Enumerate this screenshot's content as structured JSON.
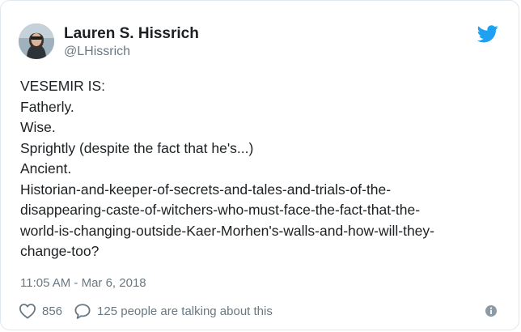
{
  "author": {
    "name": "Lauren S. Hissrich",
    "handle": "@LHissrich"
  },
  "tweet": {
    "lines": [
      "VESEMIR IS:",
      "Fatherly.",
      "Wise.",
      "Sprightly (despite the fact that he's...)",
      "Ancient.",
      "Historian-and-keeper-of-secrets-and-tales-and-trials-of-the-",
      "disappearing-caste-of-witchers-who-must-face-the-fact-that-the-",
      "world-is-changing-outside-Kaer-Morhen's-walls-and-how-will-they-",
      "change-too?"
    ],
    "timestamp": "11:05 AM - Mar 6, 2018"
  },
  "actions": {
    "like_count": "856",
    "reply_label": "125 people are talking about this"
  },
  "icons": {
    "brand": "twitter-bird-icon",
    "like": "heart-icon",
    "reply": "speech-bubble-icon",
    "info": "info-icon"
  },
  "colors": {
    "brand": "#1da1f2",
    "text": "#1c2022",
    "muted": "#697882",
    "border": "#e1e8ed"
  }
}
